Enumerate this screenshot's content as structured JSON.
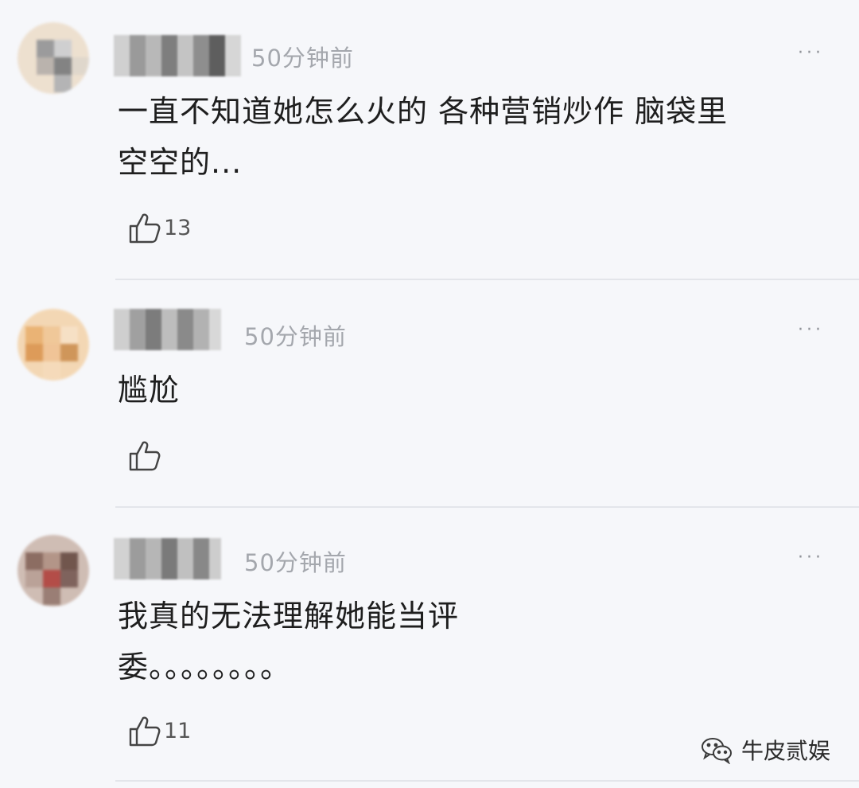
{
  "comments": [
    {
      "time": "50分钟前",
      "more": "···",
      "text": "一直不知道她怎么火的 各种营销炒作 脑袋里\n空空的...",
      "likes": "13"
    },
    {
      "time": "50分钟前",
      "more": "···",
      "text": "尴尬",
      "likes": ""
    },
    {
      "time": "50分钟前",
      "more": "···",
      "text": "我真的无法理解她能当评\n委。。。。。。。。",
      "likes": "11"
    }
  ],
  "watermark": {
    "text": "牛皮贰娱",
    "icon": "wechat-icon"
  },
  "colors": {
    "background": "#f6f7fa",
    "time": "#a4a7ad",
    "divider": "#e3e5ea"
  }
}
